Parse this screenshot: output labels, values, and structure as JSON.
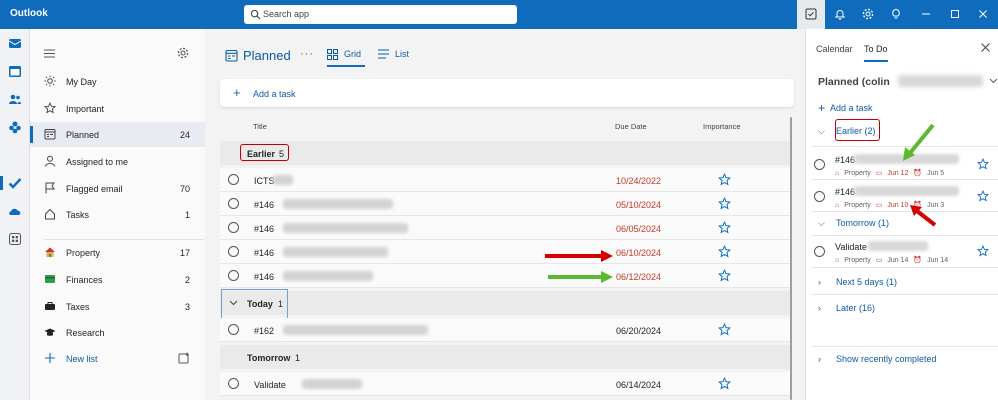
{
  "app": {
    "title": "Outlook"
  },
  "search": {
    "placeholder": "Search app"
  },
  "sidebar": {
    "items": [
      {
        "label": "My Day",
        "count": ""
      },
      {
        "label": "Important",
        "count": ""
      },
      {
        "label": "Planned",
        "count": "24"
      },
      {
        "label": "Assigned to me",
        "count": ""
      },
      {
        "label": "Flagged email",
        "count": "70"
      },
      {
        "label": "Tasks",
        "count": "1"
      }
    ],
    "lists": [
      {
        "label": "Property",
        "count": "17"
      },
      {
        "label": "Finances",
        "count": "2"
      },
      {
        "label": "Taxes",
        "count": "3"
      },
      {
        "label": "Research",
        "count": ""
      }
    ],
    "new_list": "New list"
  },
  "main": {
    "title": "Planned",
    "view_grid": "Grid",
    "view_list": "List",
    "add_task": "Add a task",
    "columns": {
      "title": "Title",
      "due": "Due Date",
      "importance": "Importance"
    },
    "groups": [
      {
        "name": "Earlier",
        "count": "5",
        "tasks": [
          {
            "title": "ICTS",
            "due": "10/24/2022"
          },
          {
            "title": "#146",
            "due": "05/10/2024"
          },
          {
            "title": "#146",
            "due": "06/05/2024"
          },
          {
            "title": "#146",
            "due": "06/10/2024"
          },
          {
            "title": "#146",
            "due": "06/12/2024"
          }
        ]
      },
      {
        "name": "Today",
        "count": "1",
        "tasks": [
          {
            "title": "#162",
            "due": "06/20/2024"
          }
        ]
      },
      {
        "name": "Tomorrow",
        "count": "1",
        "tasks": [
          {
            "title": "Validate",
            "due": "06/14/2024"
          }
        ]
      }
    ]
  },
  "rpanel": {
    "tab_calendar": "Calendar",
    "tab_todo": "To Do",
    "title": "Planned (colin",
    "add_task": "Add a task",
    "groups": {
      "earlier": "Earlier (2)",
      "tomorrow": "Tomorrow (1)",
      "next5": "Next 5 days (1)",
      "later": "Later (16)",
      "show_completed": "Show recently completed"
    },
    "tasks": [
      {
        "title": "#146",
        "list": "Property",
        "due": "Jun 12",
        "reminder": "Jun 5"
      },
      {
        "title": "#146",
        "list": "Property",
        "due": "Jun 10",
        "reminder": "Jun 3"
      },
      {
        "title": "Validate",
        "list": "Property",
        "due": "Jun 14",
        "reminder": "Jun 14"
      }
    ]
  },
  "colors": {
    "brand": "#0f6cbd",
    "overdue": "#c0392b",
    "annotation_red": "#d40000",
    "annotation_green": "#5cb82e"
  }
}
